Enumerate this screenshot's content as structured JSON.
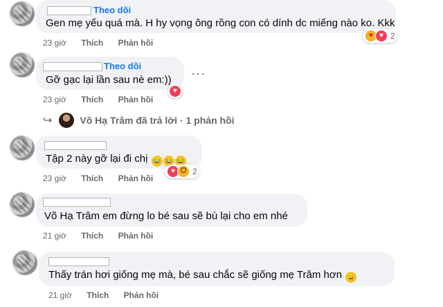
{
  "comments": [
    {
      "follow": "Theo dõi",
      "text": "Gen mẹ yếu quá mà. H hy vọng ông rồng con có dính dc miếng nào ko. Kkk",
      "time": "23 giờ",
      "like": "Thích",
      "reply": "Phản hồi",
      "reaction_count": "2",
      "reactions": [
        "care-emoji",
        "love-emoji"
      ]
    },
    {
      "follow": "Theo dõi",
      "text": "Gỡ gạc lại lần sau nè em:))",
      "time": "23 giờ",
      "like": "Thích",
      "reply": "Phản hồi",
      "more": "···",
      "reactions": [
        "love-emoji"
      ]
    },
    {
      "text": "Tập 2 này gỡ lại đi chị",
      "text_emojis": [
        "😂",
        "😂",
        "😂"
      ],
      "time": "23 giờ",
      "like": "Thích",
      "reply": "Phản hồi",
      "reaction_count": "2",
      "reactions": [
        "love-emoji",
        "haha-emoji"
      ]
    },
    {
      "text": "Võ Hạ Trâm em đừng lo bé sau sẽ bù lại cho em nhé",
      "time": "21 giờ",
      "like": "Thích",
      "reply": "Phản hồi"
    },
    {
      "text": "Thấy trán hơi giống mẹ mà, bé sau chắc sẽ giống mẹ Trâm hơn",
      "text_emoji": "😄",
      "time": "21 giờ",
      "like": "Thích",
      "reply": "Phản hồi"
    }
  ],
  "replies_summary": {
    "arrow": "↪",
    "label": "Võ Hạ Trâm đã trả lời · 1 phản hồi"
  },
  "colors": {
    "link": "#1877f2",
    "bubble": "#f0f2f5",
    "meta": "#65676b"
  }
}
